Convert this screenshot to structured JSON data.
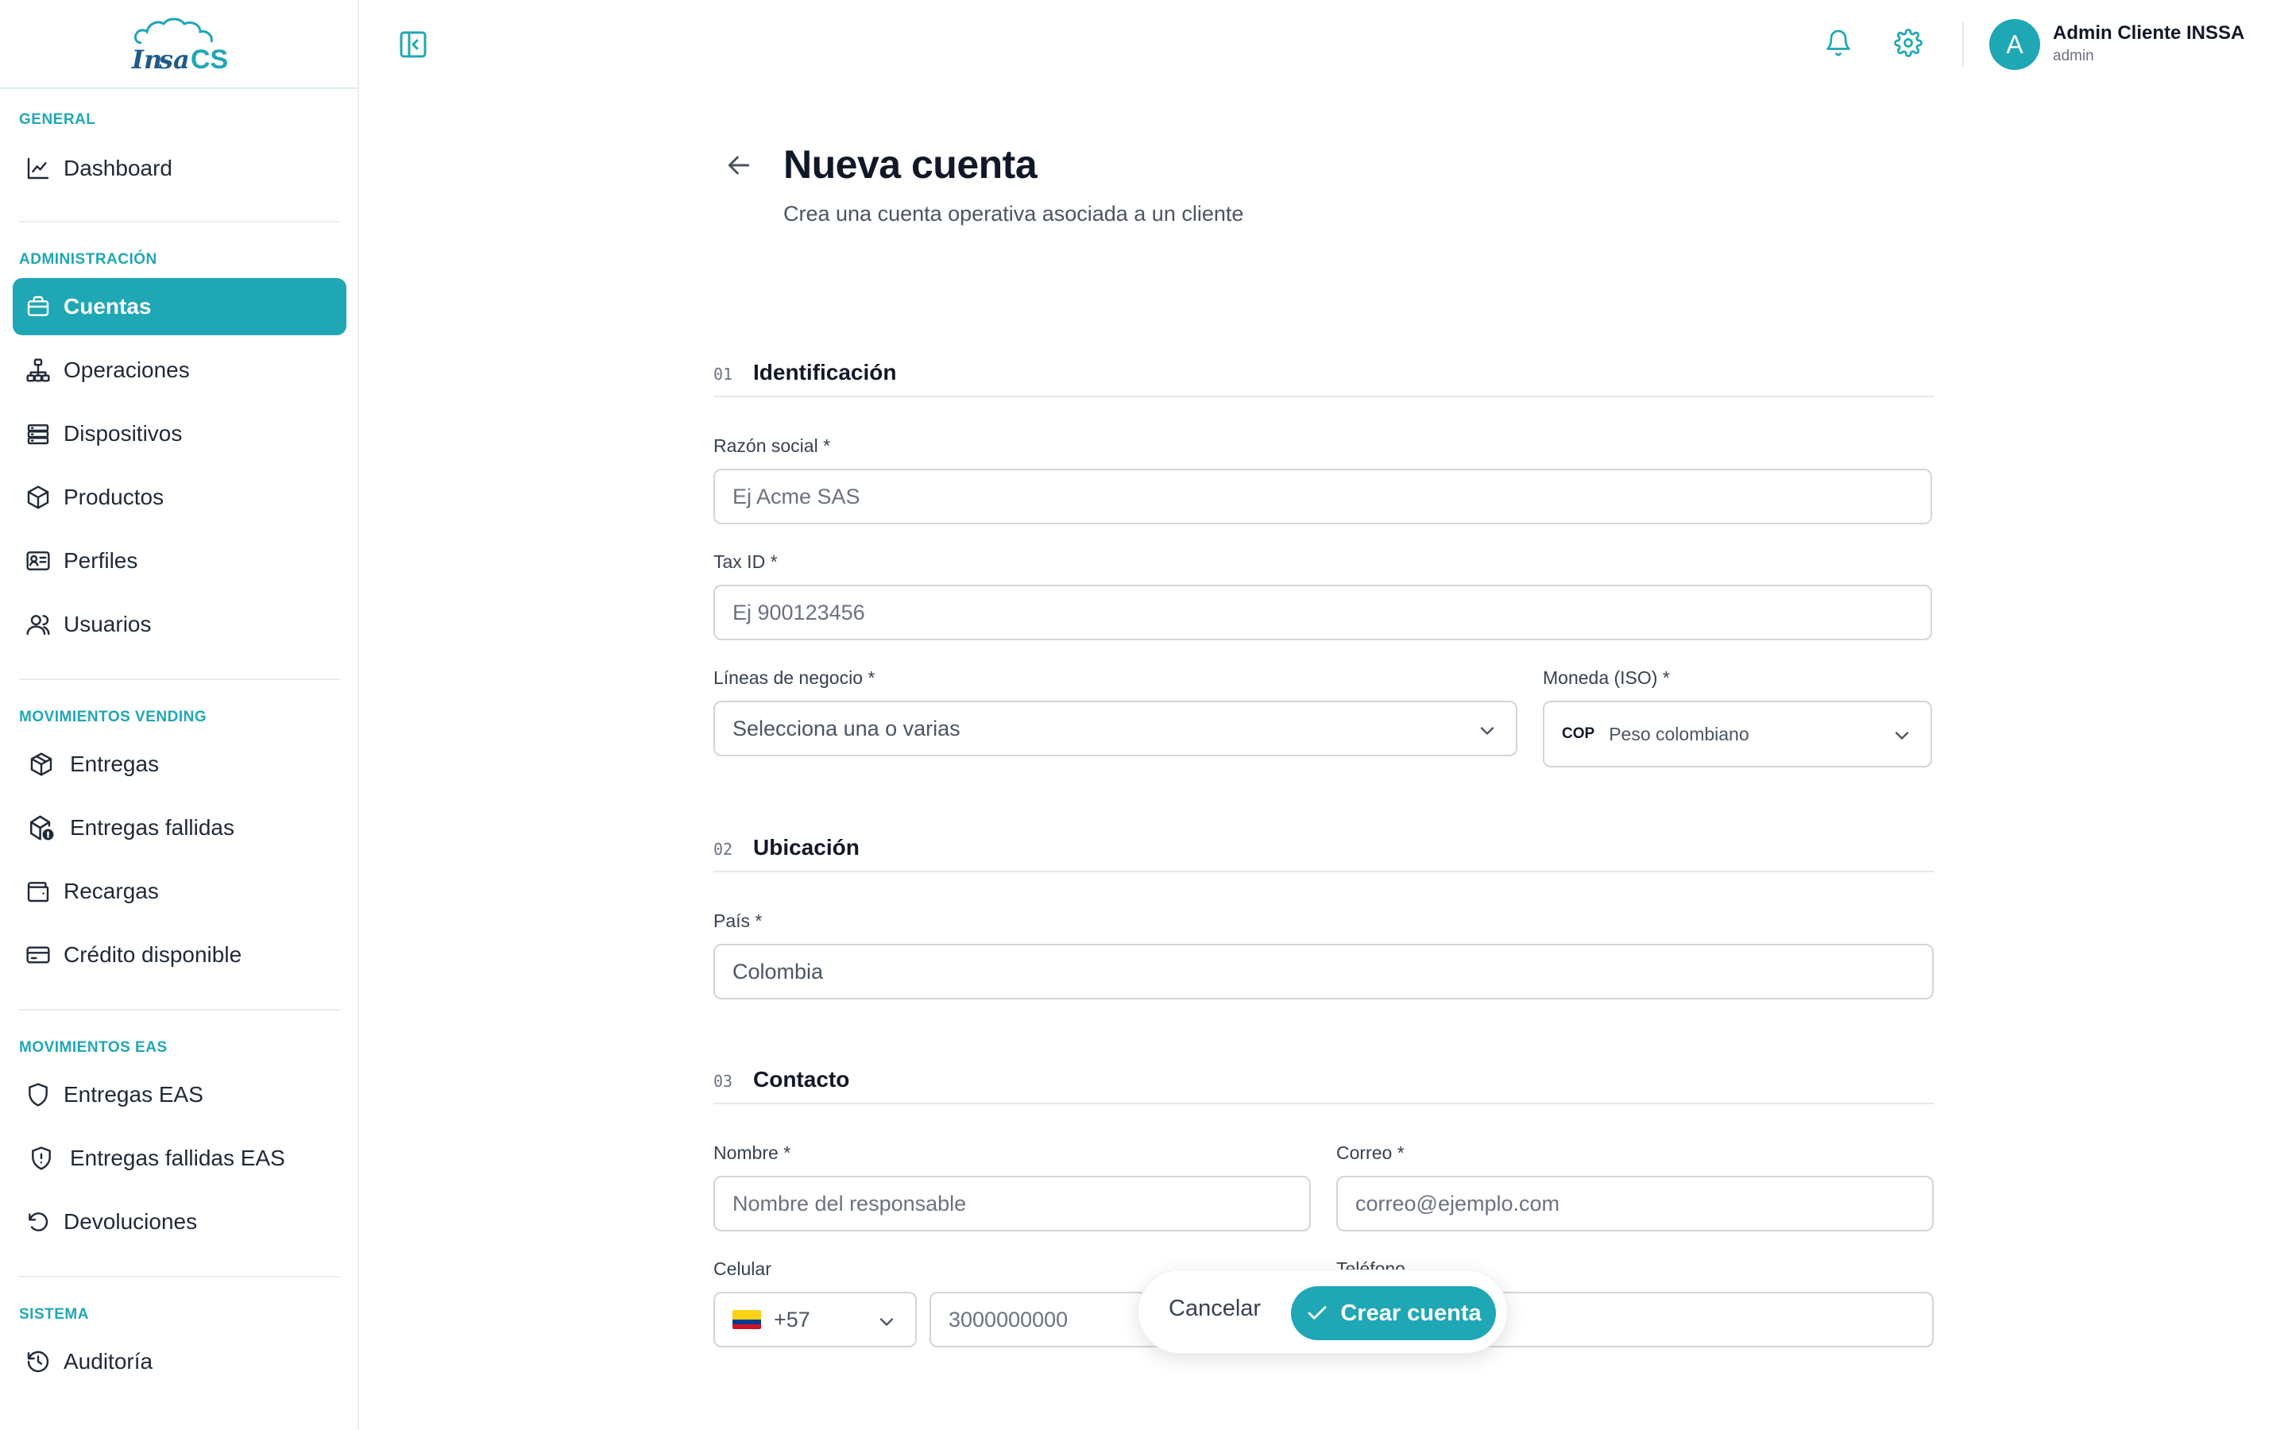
{
  "app": {
    "logo_text": "INSSA CS",
    "brand_color": "#1fa7b5"
  },
  "sidebar": {
    "sections": [
      {
        "title": "GENERAL",
        "items": [
          {
            "label": "Dashboard",
            "icon": "chart-line-icon"
          }
        ]
      },
      {
        "title": "ADMINISTRACIÓN",
        "items": [
          {
            "label": "Cuentas",
            "icon": "briefcase-icon",
            "active": true
          },
          {
            "label": "Operaciones",
            "icon": "network-icon"
          },
          {
            "label": "Dispositivos",
            "icon": "server-icon"
          },
          {
            "label": "Productos",
            "icon": "box-icon"
          },
          {
            "label": "Perfiles",
            "icon": "id-card-icon"
          },
          {
            "label": "Usuarios",
            "icon": "users-icon"
          }
        ]
      },
      {
        "title": "MOVIMIENTOS VENDING",
        "items": [
          {
            "label": "Entregas",
            "icon": "package-icon"
          },
          {
            "label": "Entregas fallidas",
            "icon": "package-alert-icon"
          },
          {
            "label": "Recargas",
            "icon": "wallet-icon"
          },
          {
            "label": "Crédito disponible",
            "icon": "credit-card-icon"
          }
        ]
      },
      {
        "title": "MOVIMIENTOS EAS",
        "items": [
          {
            "label": "Entregas EAS",
            "icon": "shield-icon"
          },
          {
            "label": "Entregas fallidas EAS",
            "icon": "shield-alert-icon"
          },
          {
            "label": "Devoluciones",
            "icon": "undo-icon"
          }
        ]
      },
      {
        "title": "SISTEMA",
        "items": [
          {
            "label": "Auditoría",
            "icon": "history-icon"
          }
        ]
      }
    ]
  },
  "header": {
    "user": {
      "initial": "A",
      "name": "Admin Cliente INSSA",
      "role": "admin"
    }
  },
  "page": {
    "title": "Nueva cuenta",
    "subtitle": "Crea una cuenta operativa asociada a un cliente"
  },
  "form": {
    "sections": {
      "identificacion": {
        "number": "01",
        "title": "Identificación"
      },
      "ubicacion": {
        "number": "02",
        "title": "Ubicación"
      },
      "contacto": {
        "number": "03",
        "title": "Contacto"
      }
    },
    "razon_social": {
      "label": "Razón social *",
      "placeholder": "Ej Acme SAS",
      "value": ""
    },
    "tax_id": {
      "label": "Tax ID *",
      "placeholder": "Ej 900123456",
      "value": ""
    },
    "lineas_negocio": {
      "label": "Líneas de negocio *",
      "placeholder": "Selecciona una o varias"
    },
    "moneda": {
      "label": "Moneda (ISO) *",
      "code": "COP",
      "name": "Peso colombiano"
    },
    "pais": {
      "label": "País *",
      "value": "Colombia"
    },
    "nombre": {
      "label": "Nombre *",
      "placeholder": "Nombre del responsable",
      "value": ""
    },
    "correo": {
      "label": "Correo *",
      "placeholder": "correo@ejemplo.com",
      "value": ""
    },
    "celular": {
      "label": "Celular",
      "dial_code": "+57",
      "placeholder": "3000000000",
      "value": ""
    },
    "telefono": {
      "label": "Teléfono",
      "value": ""
    }
  },
  "actions": {
    "cancel_label": "Cancelar",
    "create_label": "Crear cuenta"
  }
}
